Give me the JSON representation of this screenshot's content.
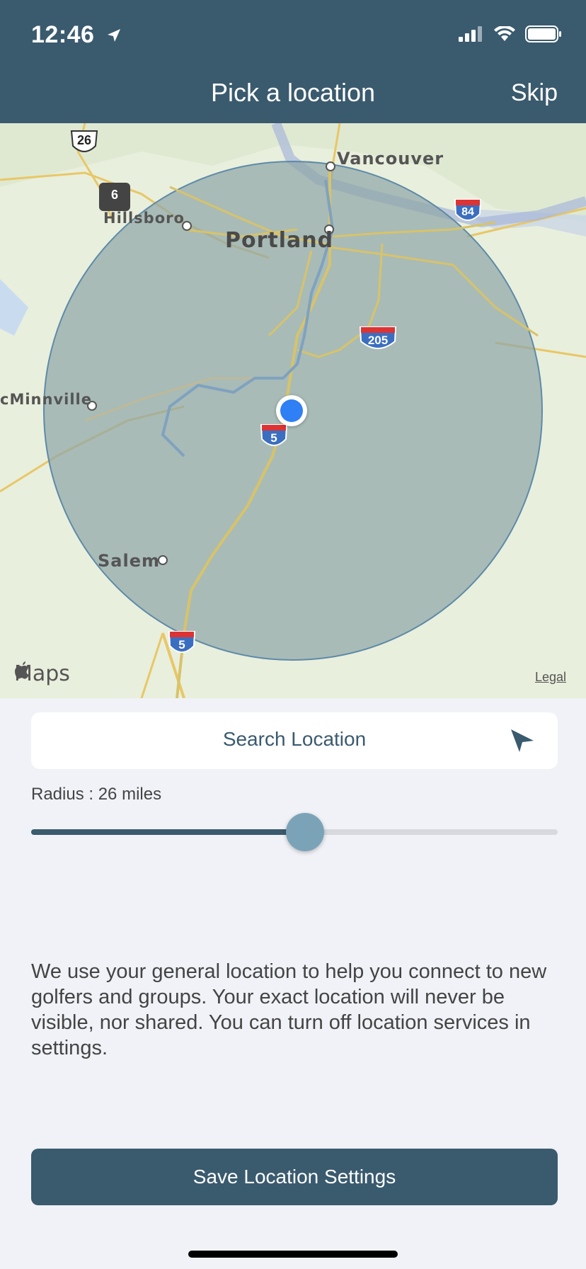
{
  "status_bar": {
    "time": "12:46"
  },
  "header": {
    "title": "Pick a location",
    "skip_label": "Skip"
  },
  "map": {
    "labels": {
      "vancouver": "Vancouver",
      "portland": "Portland",
      "hillsboro": "Hillsboro",
      "mcminnville": "cMinnville",
      "salem": "Salem"
    },
    "shields": {
      "us26": "26",
      "or6": "6",
      "i84": "84",
      "i205": "205",
      "i5_center": "5",
      "i5_south": "5"
    },
    "brand": "Maps",
    "legal_label": "Legal",
    "colors": {
      "radius_fill": "#8fa6a8",
      "pin": "#2f7ff5",
      "land": "#e8efdc"
    }
  },
  "search": {
    "label": "Search Location"
  },
  "radius": {
    "label": "Radius : 26 miles",
    "slider_fraction": 0.52
  },
  "info_text": "We use your general location to help you connect to new golfers and groups. Your exact location will never be visible, nor shared. You can turn off location services in settings.",
  "save_button": {
    "label": "Save Location Settings"
  }
}
